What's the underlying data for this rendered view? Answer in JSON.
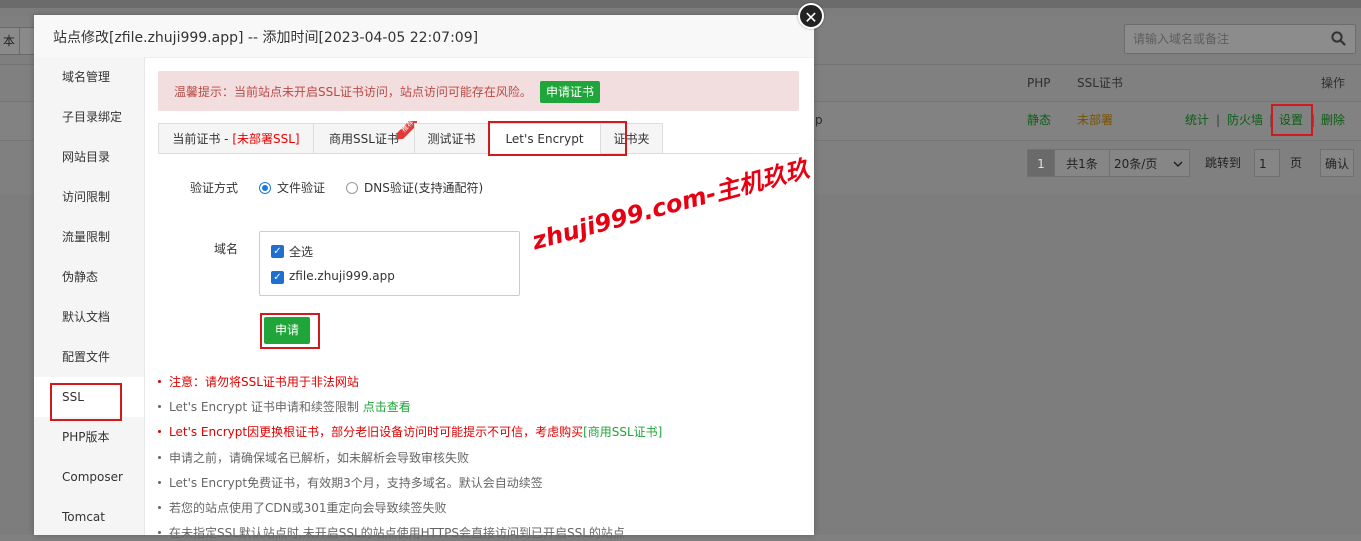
{
  "background": {
    "left_button": "本",
    "search_placeholder": "请输入域名或备注",
    "columns": {
      "php": "PHP",
      "ssl": "SSL证书",
      "actions": "操作"
    },
    "row": {
      "partial": "p",
      "php": "静态",
      "ssl": "未部署",
      "actions": {
        "stats": "统计",
        "firewall": "防火墙",
        "settings": "设置",
        "delete": "删除",
        "sep": "|"
      }
    },
    "pagination": {
      "current_page": "1",
      "total": "共1条",
      "per_page": "20条/页",
      "jump_label": "跳转到",
      "jump_value": "1",
      "page_unit": "页",
      "confirm": "确认"
    }
  },
  "modal": {
    "title": "站点修改[zfile.zhuji999.app] -- 添加时间[2023-04-05 22:07:09]",
    "close_glyph": "✕",
    "sidebar": [
      {
        "label": "域名管理"
      },
      {
        "label": "子目录绑定"
      },
      {
        "label": "网站目录"
      },
      {
        "label": "访问限制"
      },
      {
        "label": "流量限制"
      },
      {
        "label": "伪静态"
      },
      {
        "label": "默认文档"
      },
      {
        "label": "配置文件"
      },
      {
        "label": "SSL"
      },
      {
        "label": "PHP版本"
      },
      {
        "label": "Composer"
      },
      {
        "label": "Tomcat"
      }
    ],
    "tip": {
      "text": "温馨提示：当前站点未开启SSL证书访问，站点访问可能存在风险。",
      "button": "申请证书"
    },
    "tabs": {
      "current": "当前证书 - ",
      "current_status": "[未部署SSL]",
      "commercial": "商用SSL证书",
      "commercial_badge": "推荐",
      "test": "测试证书",
      "letsencrypt": "Let's Encrypt",
      "folder": "证书夹"
    },
    "verify": {
      "label": "验证方式",
      "option_file": "文件验证",
      "option_dns": "DNS验证(支持通配符)"
    },
    "domain": {
      "label": "域名",
      "select_all": "全选",
      "item": "zfile.zhuji999.app"
    },
    "apply_button": "申请",
    "notes": {
      "n1": "注意：请勿将SSL证书用于非法网站",
      "n2_text": "Let's Encrypt 证书申请和续签限制 ",
      "n2_link": "点击查看",
      "n3_text": "Let's Encrypt因更换根证书，部分老旧设备访问时可能提示不可信，考虑购买",
      "n3_link": "[商用SSL证书]",
      "n4": "申请之前，请确保域名已解析，如未解析会导致审核失败",
      "n5": "Let's Encrypt免费证书，有效期3个月，支持多域名。默认会自动续签",
      "n6": "若您的站点使用了CDN或301重定向会导致续签失败",
      "n7": "在未指定SSL默认站点时,未开启SSL的站点使用HTTPS会直接访问到已开启SSL的站点"
    }
  },
  "watermark": "zhuji999.com-主机玖玖",
  "colors": {
    "accent_green": "#20a53a",
    "warn_red": "#e00000",
    "highlight_box": "#d11a1a"
  }
}
